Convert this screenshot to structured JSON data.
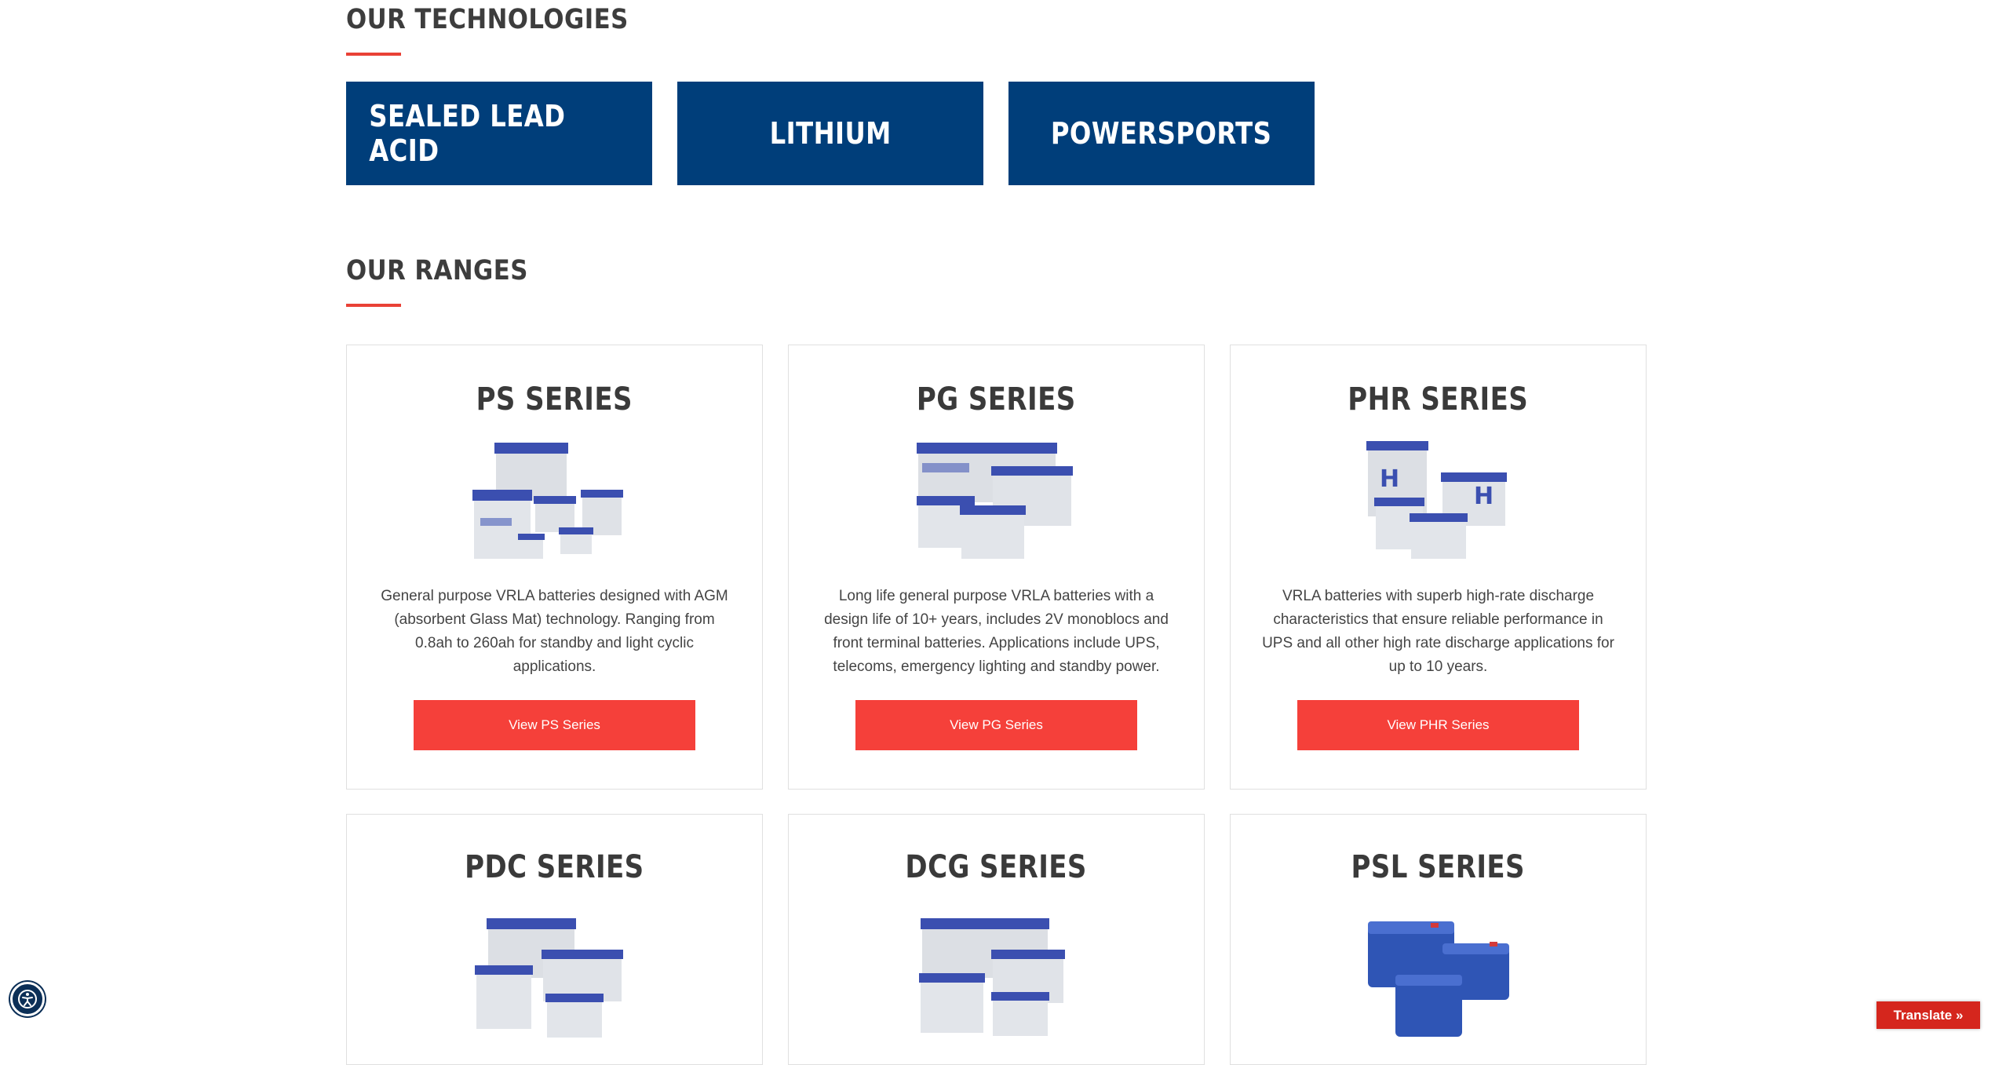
{
  "technologies": {
    "heading": "OUR TECHNOLOGIES",
    "tiles": [
      {
        "label": "SEALED LEAD ACID"
      },
      {
        "label": "LITHIUM"
      },
      {
        "label": "POWERSPORTS"
      }
    ]
  },
  "ranges": {
    "heading": "OUR RANGES",
    "cards": [
      {
        "title": "PS SERIES",
        "description": "General purpose VRLA batteries designed with AGM (absorbent Glass Mat) technology. Ranging from 0.8ah to 260ah for standby and light cyclic applications.",
        "button": "View PS Series"
      },
      {
        "title": "PG SERIES",
        "description": "Long life general purpose VRLA batteries with a design life of 10+ years, includes 2V monoblocs and front terminal batteries. Applications include UPS, telecoms, emergency lighting and standby power.",
        "button": "View PG Series"
      },
      {
        "title": "PHR SERIES",
        "description": "VRLA batteries with superb high-rate discharge characteristics that ensure reliable performance in UPS and all other high rate discharge applications for up to 10 years.",
        "button": "View PHR Series"
      },
      {
        "title": "PDC SERIES"
      },
      {
        "title": "DCG SERIES"
      },
      {
        "title": "PSL SERIES"
      }
    ]
  },
  "widgets": {
    "translate": "Translate »"
  },
  "colors": {
    "tile_blue": "#003e7a",
    "accent_red": "#f5403a",
    "underline_red": "#e94136",
    "battery_lid_blue": "#3b4fb0",
    "battery_body_grey": "#dcdfe4"
  }
}
